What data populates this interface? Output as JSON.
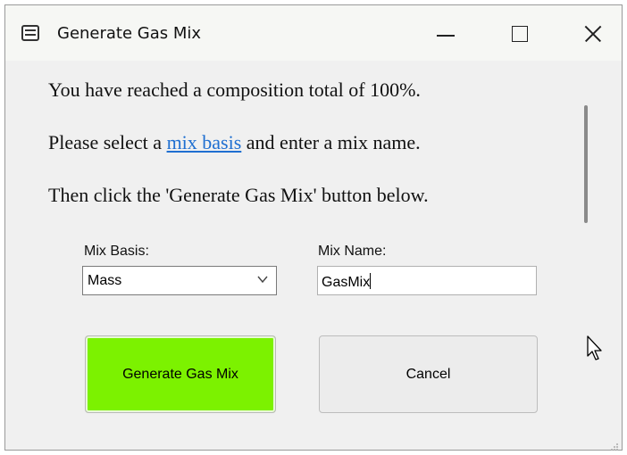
{
  "window": {
    "title": "Generate Gas Mix",
    "icon": "app-icon"
  },
  "message": {
    "line1": "You have reached a composition total of 100%.",
    "line2_prefix": "Please select a ",
    "line2_link": "mix basis",
    "line2_suffix": " and enter a mix name.",
    "line3": "Then click the 'Generate Gas Mix' button below."
  },
  "form": {
    "mix_basis_label": "Mix Basis:",
    "mix_basis_value": "Mass",
    "mix_name_label": "Mix Name:",
    "mix_name_value": "GasMix"
  },
  "buttons": {
    "generate_label": "Generate Gas Mix",
    "cancel_label": "Cancel"
  },
  "colors": {
    "generate_button": "#7cf200",
    "link": "#1f6fd1"
  }
}
